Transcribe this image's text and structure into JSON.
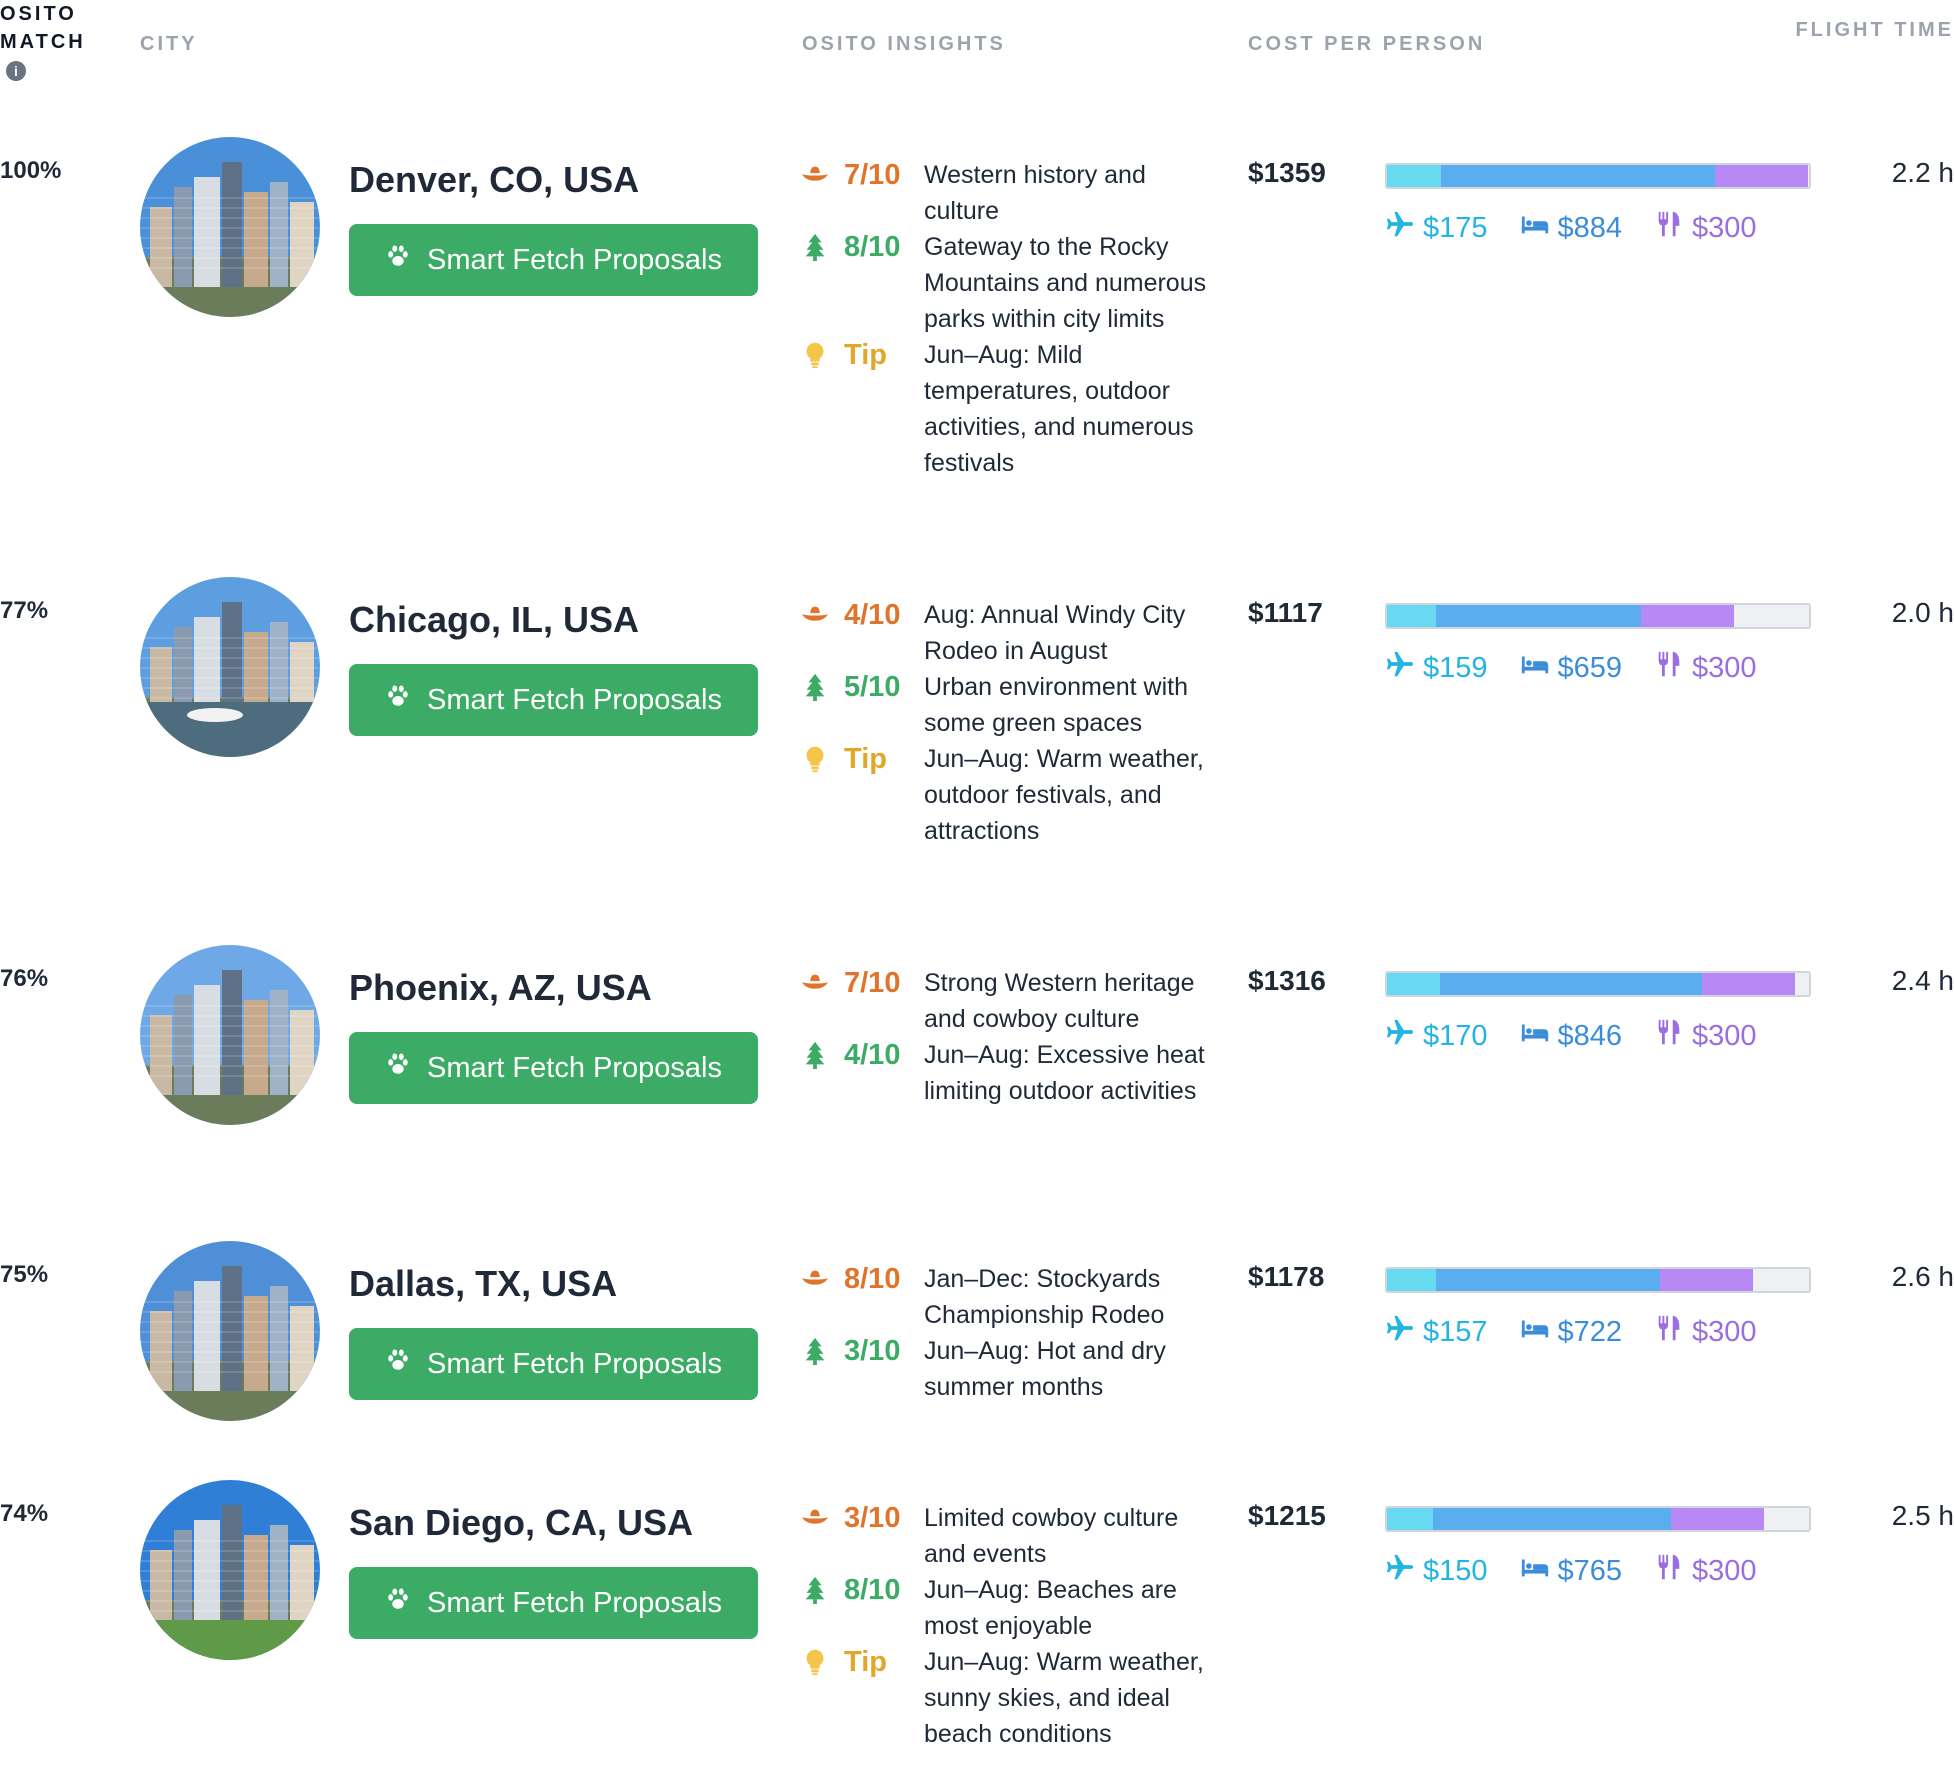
{
  "header": {
    "match": "OSITO MATCH",
    "info_icon": "info-icon",
    "city": "CITY",
    "insights": "OSITO INSIGHTS",
    "cost": "COST PER PERSON",
    "flight": "FLIGHT TIME"
  },
  "button_label": "Smart Fetch Proposals",
  "colors": {
    "button": "#3cab65",
    "cowboy": "#e0742b",
    "nature": "#3cab65",
    "tip": "#e1a72a",
    "flight": "#67d9f0",
    "hotel": "#5aaef0",
    "meals": "#b889f5"
  },
  "rows": [
    {
      "match": "100%",
      "city": "Denver, CO, USA",
      "photo": "denver-skyline",
      "insights": [
        {
          "icon": "cowboy-hat-icon",
          "kind": "cowboy",
          "score": "7/10",
          "text": "Western history and culture"
        },
        {
          "icon": "tree-icon",
          "kind": "nature",
          "score": "8/10",
          "text": "Gateway to the Rocky Mountains and numerous parks within city limits"
        },
        {
          "icon": "lightbulb-icon",
          "kind": "tip",
          "score": "Tip",
          "text": "Jun–Aug: Mild temperatures, outdoor activities, and numerous festivals"
        }
      ],
      "total": "$1359",
      "flight_cost": "$175",
      "hotel_cost": "$884",
      "meals_cost": "$300",
      "flight_time": "2.2 h",
      "bar_fractions": [
        0.129,
        0.65,
        0.221
      ]
    },
    {
      "match": "77%",
      "city": "Chicago, IL, USA",
      "photo": "chicago-river",
      "insights": [
        {
          "icon": "cowboy-hat-icon",
          "kind": "cowboy",
          "score": "4/10",
          "text": "Aug: Annual Windy City Rodeo in August"
        },
        {
          "icon": "tree-icon",
          "kind": "nature",
          "score": "5/10",
          "text": "Urban environment with some green spaces"
        },
        {
          "icon": "lightbulb-icon",
          "kind": "tip",
          "score": "Tip",
          "text": "Jun–Aug: Warm weather, outdoor festivals, and attractions"
        }
      ],
      "total": "$1117",
      "flight_cost": "$159",
      "hotel_cost": "$659",
      "meals_cost": "$300",
      "flight_time": "2.0 h",
      "bar_fractions": [
        0.117,
        0.485,
        0.221
      ]
    },
    {
      "match": "76%",
      "city": "Phoenix, AZ, USA",
      "photo": "phoenix-street",
      "insights": [
        {
          "icon": "cowboy-hat-icon",
          "kind": "cowboy",
          "score": "7/10",
          "text": "Strong Western heritage and cowboy culture"
        },
        {
          "icon": "tree-icon",
          "kind": "nature",
          "score": "4/10",
          "text": "Jun–Aug: Excessive heat limiting outdoor activities"
        }
      ],
      "total": "$1316",
      "flight_cost": "$170",
      "hotel_cost": "$846",
      "meals_cost": "$300",
      "flight_time": "2.4 h",
      "bar_fractions": [
        0.125,
        0.622,
        0.221
      ]
    },
    {
      "match": "75%",
      "city": "Dallas, TX, USA",
      "photo": "dallas-skyline",
      "insights": [
        {
          "icon": "cowboy-hat-icon",
          "kind": "cowboy",
          "score": "8/10",
          "text": "Jan–Dec: Stockyards Championship Rodeo"
        },
        {
          "icon": "tree-icon",
          "kind": "nature",
          "score": "3/10",
          "text": "Jun–Aug: Hot and dry summer months"
        }
      ],
      "total": "$1178",
      "flight_cost": "$157",
      "hotel_cost": "$722",
      "meals_cost": "$300",
      "flight_time": "2.6 h",
      "bar_fractions": [
        0.115,
        0.531,
        0.221
      ]
    },
    {
      "match": "74%",
      "city": "San Diego, CA, USA",
      "photo": "san-diego-skyline",
      "insights": [
        {
          "icon": "cowboy-hat-icon",
          "kind": "cowboy",
          "score": "3/10",
          "text": "Limited cowboy culture and events"
        },
        {
          "icon": "tree-icon",
          "kind": "nature",
          "score": "8/10",
          "text": "Jun–Aug: Beaches are most enjoyable"
        },
        {
          "icon": "lightbulb-icon",
          "kind": "tip",
          "score": "Tip",
          "text": "Jun–Aug: Warm weather, sunny skies, and ideal beach conditions"
        }
      ],
      "total": "$1215",
      "flight_cost": "$150",
      "hotel_cost": "$765",
      "meals_cost": "$300",
      "flight_time": "2.5 h",
      "bar_fractions": [
        0.11,
        0.563,
        0.221
      ]
    }
  ]
}
